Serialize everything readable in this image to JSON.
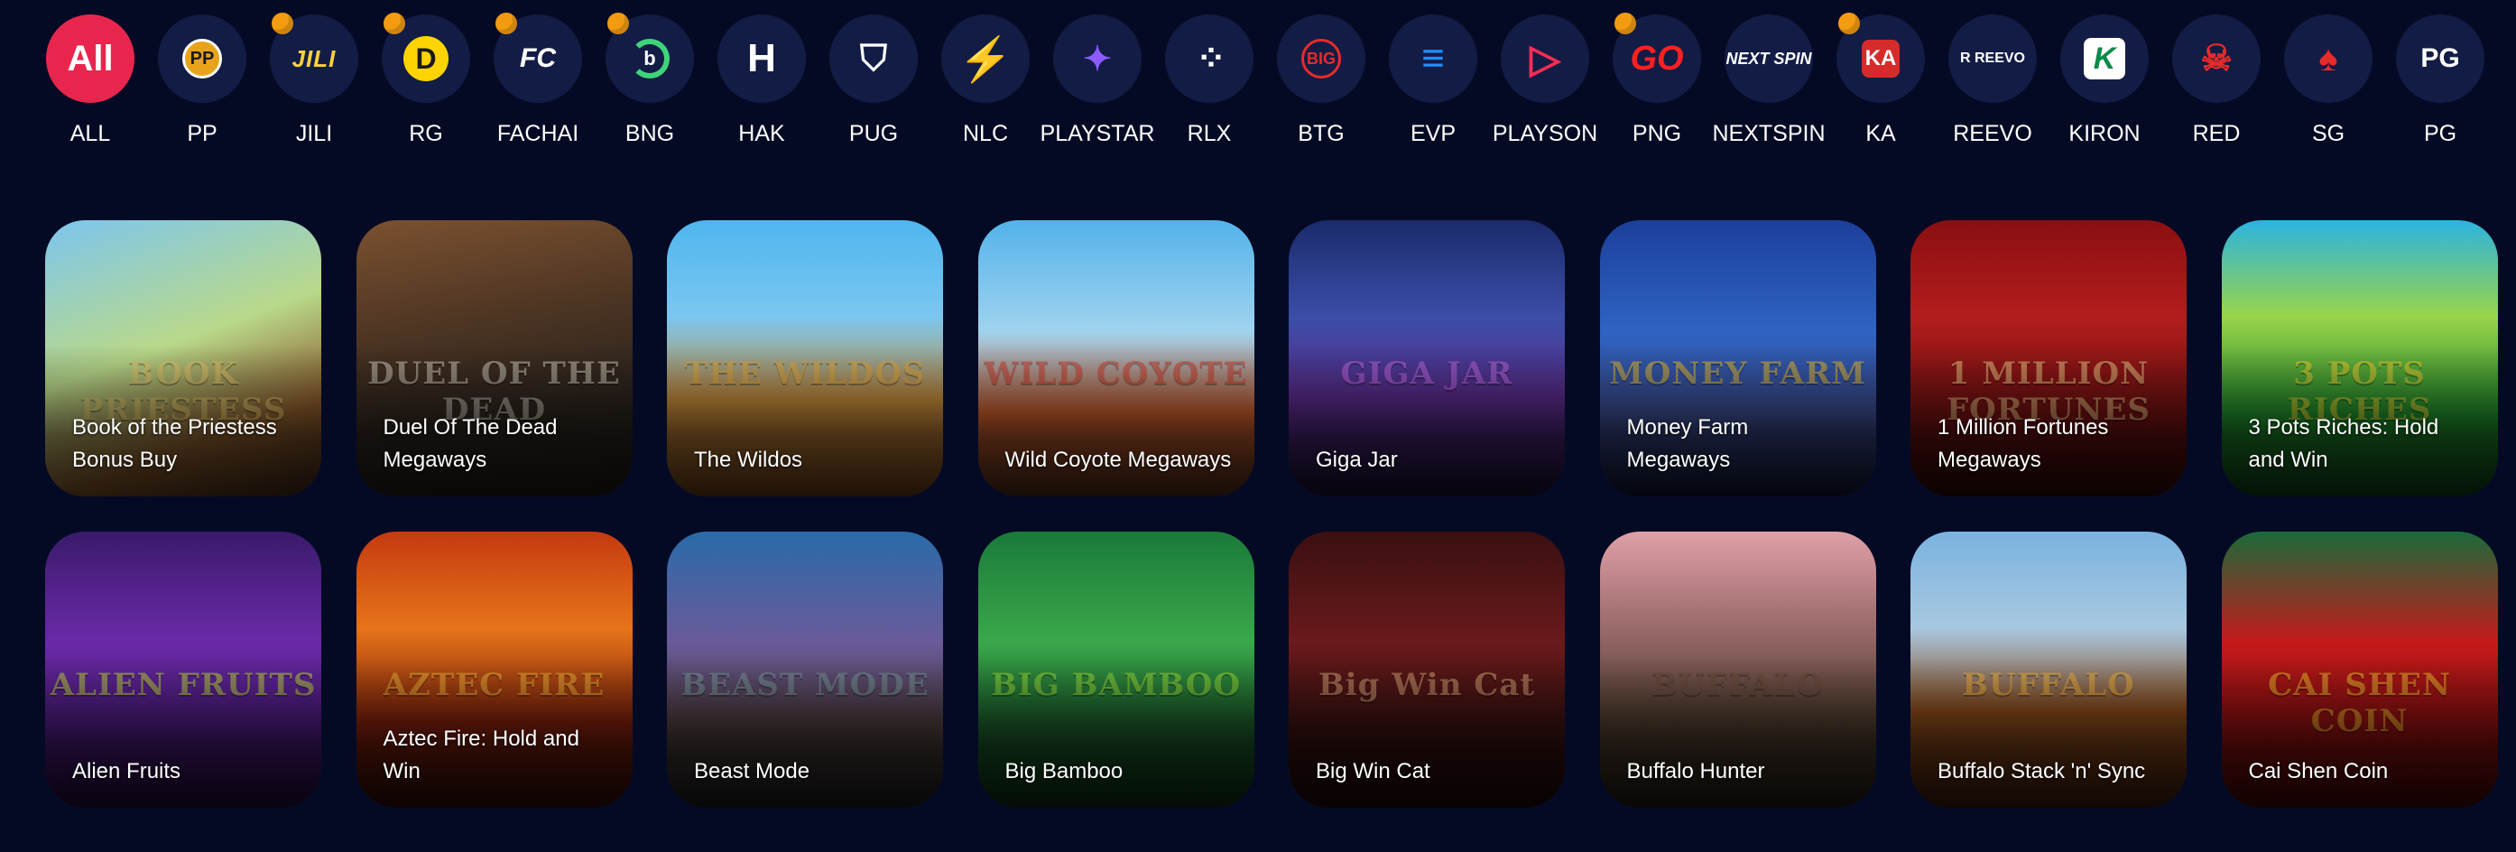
{
  "providers": [
    {
      "label": "ALL",
      "icon": "all-icon",
      "glyph": "All",
      "active": true
    },
    {
      "label": "PP",
      "icon": "pragmatic-play-logo-icon",
      "glyph": "PP",
      "badge": false
    },
    {
      "label": "JILI",
      "icon": "jili-logo-icon",
      "glyph": "JILI",
      "badge": true
    },
    {
      "label": "RG",
      "icon": "rg-logo-icon",
      "glyph": "D",
      "badge": true
    },
    {
      "label": "FACHAI",
      "icon": "fachai-logo-icon",
      "glyph": "FC",
      "badge": true
    },
    {
      "label": "BNG",
      "icon": "bng-logo-icon",
      "glyph": "b",
      "badge": true
    },
    {
      "label": "HAK",
      "icon": "hak-logo-icon",
      "glyph": "H",
      "badge": false
    },
    {
      "label": "PUG",
      "icon": "pug-logo-icon",
      "glyph": "⛉",
      "badge": false
    },
    {
      "label": "NLC",
      "icon": "nlc-bolt-icon",
      "glyph": "⚡",
      "badge": false
    },
    {
      "label": "PLAYSTAR",
      "icon": "playstar-logo-icon",
      "glyph": "✦",
      "badge": false
    },
    {
      "label": "RLX",
      "icon": "rlx-dots-icon",
      "glyph": "⁘",
      "badge": false
    },
    {
      "label": "BTG",
      "icon": "btg-logo-icon",
      "glyph": "BIG",
      "badge": false
    },
    {
      "label": "EVP",
      "icon": "evp-logo-icon",
      "glyph": "≡",
      "badge": false
    },
    {
      "label": "PLAYSON",
      "icon": "playson-logo-icon",
      "glyph": "▷",
      "badge": false
    },
    {
      "label": "PNG",
      "icon": "png-logo-icon",
      "glyph": "GO",
      "badge": true
    },
    {
      "label": "NEXTSPIN",
      "icon": "nextspin-logo-icon",
      "glyph": "NEXT SPIN",
      "badge": false
    },
    {
      "label": "KA",
      "icon": "ka-logo-icon",
      "glyph": "KA",
      "badge": true
    },
    {
      "label": "REEVO",
      "icon": "reevo-logo-icon",
      "glyph": "R REEVO",
      "badge": false
    },
    {
      "label": "KIRON",
      "icon": "kiron-logo-icon",
      "glyph": "K",
      "badge": false
    },
    {
      "label": "RED",
      "icon": "red-tiger-logo-icon",
      "glyph": "☠",
      "badge": false
    },
    {
      "label": "SG",
      "icon": "sg-logo-icon",
      "glyph": "♠",
      "badge": false
    },
    {
      "label": "PG",
      "icon": "pg-logo-icon",
      "glyph": "PG",
      "badge": false
    }
  ],
  "games": [
    {
      "name": "Book of the Priestess Bonus Buy",
      "art": "linear-gradient(160deg,#7cc6ef 0%,#b9d98a 45%,#8a5a2b 75%,#3a2414 100%)",
      "deco": "BOOK PRIESTESS",
      "decoColor": "#e7c66a"
    },
    {
      "name": "Duel Of The Dead Megaways",
      "art": "linear-gradient(170deg,#7b5130 0%,#4a3322 40%,#2a231d 70%,#1d1915 100%)",
      "deco": "DUEL OF THE DEAD",
      "decoColor": "#d9d4c5"
    },
    {
      "name": "The Wildos",
      "art": "linear-gradient(180deg,#4fb6ef 0%,#7ac7ef 35%,#c48a3a 65%,#6a3c18 100%)",
      "deco": "THE WILDOS",
      "decoColor": "#e7a93a"
    },
    {
      "name": "Wild Coyote Megaways",
      "art": "linear-gradient(180deg,#53b3ea 0%,#9fd3ef 40%,#c75a2a 70%,#4a2a18 100%)",
      "deco": "WILD COYOTE",
      "decoColor": "#d23a2a"
    },
    {
      "name": "Giga Jar",
      "art": "linear-gradient(180deg,#1a2a6a 0%,#3b4ea8 35%,#5b2a8a 65%,#150f2e 100%)",
      "deco": "GIGA JAR",
      "decoColor": "#c46ae7"
    },
    {
      "name": "Money Farm Megaways",
      "art": "linear-gradient(180deg,#1b3f9a 0%,#2f63c4 40%,#3a4a8a 70%,#0d1330 100%)",
      "deco": "MONEY FARM",
      "decoColor": "#f2c12e"
    },
    {
      "name": "1 Million Fortunes Megaways",
      "art": "linear-gradient(180deg,#8a0f12 0%,#b31c1c 35%,#6e1010 70%,#2a0707 100%)",
      "deco": "1 MILLION FORTUNES",
      "decoColor": "#f2d08a"
    },
    {
      "name": "3 Pots Riches: Hold and Win",
      "art": "linear-gradient(180deg,#2bb3e0 0%,#9ad44a 35%,#1f8a2a 70%,#0d3b14 100%)",
      "deco": "3 POTS RICHES",
      "decoColor": "#f2d22e"
    },
    {
      "name": "Alien Fruits",
      "art": "linear-gradient(180deg,#3a1a6a 0%,#6a2aa8 40%,#4a1a7a 70%,#1e0a36 100%)",
      "deco": "ALIEN FRUITS",
      "decoColor": "#c2e03a"
    },
    {
      "name": "Aztec Fire: Hold and Win",
      "art": "linear-gradient(180deg,#c43a10 0%,#e6741a 35%,#7a1e0a 70%,#2a0a05 100%)",
      "deco": "AZTEC FIRE",
      "decoColor": "#f2b23a"
    },
    {
      "name": "Beast Mode",
      "art": "linear-gradient(180deg,#2a6aa8 0%,#6a5a9a 40%,#4a3a3a 70%,#1a1a1a 100%)",
      "deco": "BEAST MODE",
      "decoColor": "#7a9a9a"
    },
    {
      "name": "Big Bamboo",
      "art": "linear-gradient(180deg,#1a7a3a 0%,#3aa84a 40%,#1a5a2a 70%,#0a2a12 100%)",
      "deco": "BIG BAMBOO",
      "decoColor": "#9ae03a"
    },
    {
      "name": "Big Win Cat",
      "art": "linear-gradient(180deg,#3a0f12 0%,#6a1a1a 40%,#3a1010 70%,#1a0707 100%)",
      "deco": "Big Win Cat",
      "decoColor": "#d9a87a"
    },
    {
      "name": "Buffalo Hunter",
      "art": "linear-gradient(180deg,#e0a0a8 0%,#9a6a6a 35%,#4a3a2a 70%,#1e1812 100%)",
      "deco": "BUFFALO",
      "decoColor": "#6a4a3a"
    },
    {
      "name": "Buffalo Stack 'n' Sync",
      "art": "linear-gradient(180deg,#7ab3e0 0%,#a8c8e0 35%,#8a4a1a 65%,#3a1a0a 100%)",
      "deco": "BUFFALO",
      "decoColor": "#f2b23a"
    },
    {
      "name": "Cai Shen Coin",
      "art": "linear-gradient(180deg,#1a6a3a 0%,#c41a1a 40%,#8a0f0f 70%,#3a0505 100%)",
      "deco": "CAI SHEN COIN",
      "decoColor": "#f2c12e"
    }
  ]
}
